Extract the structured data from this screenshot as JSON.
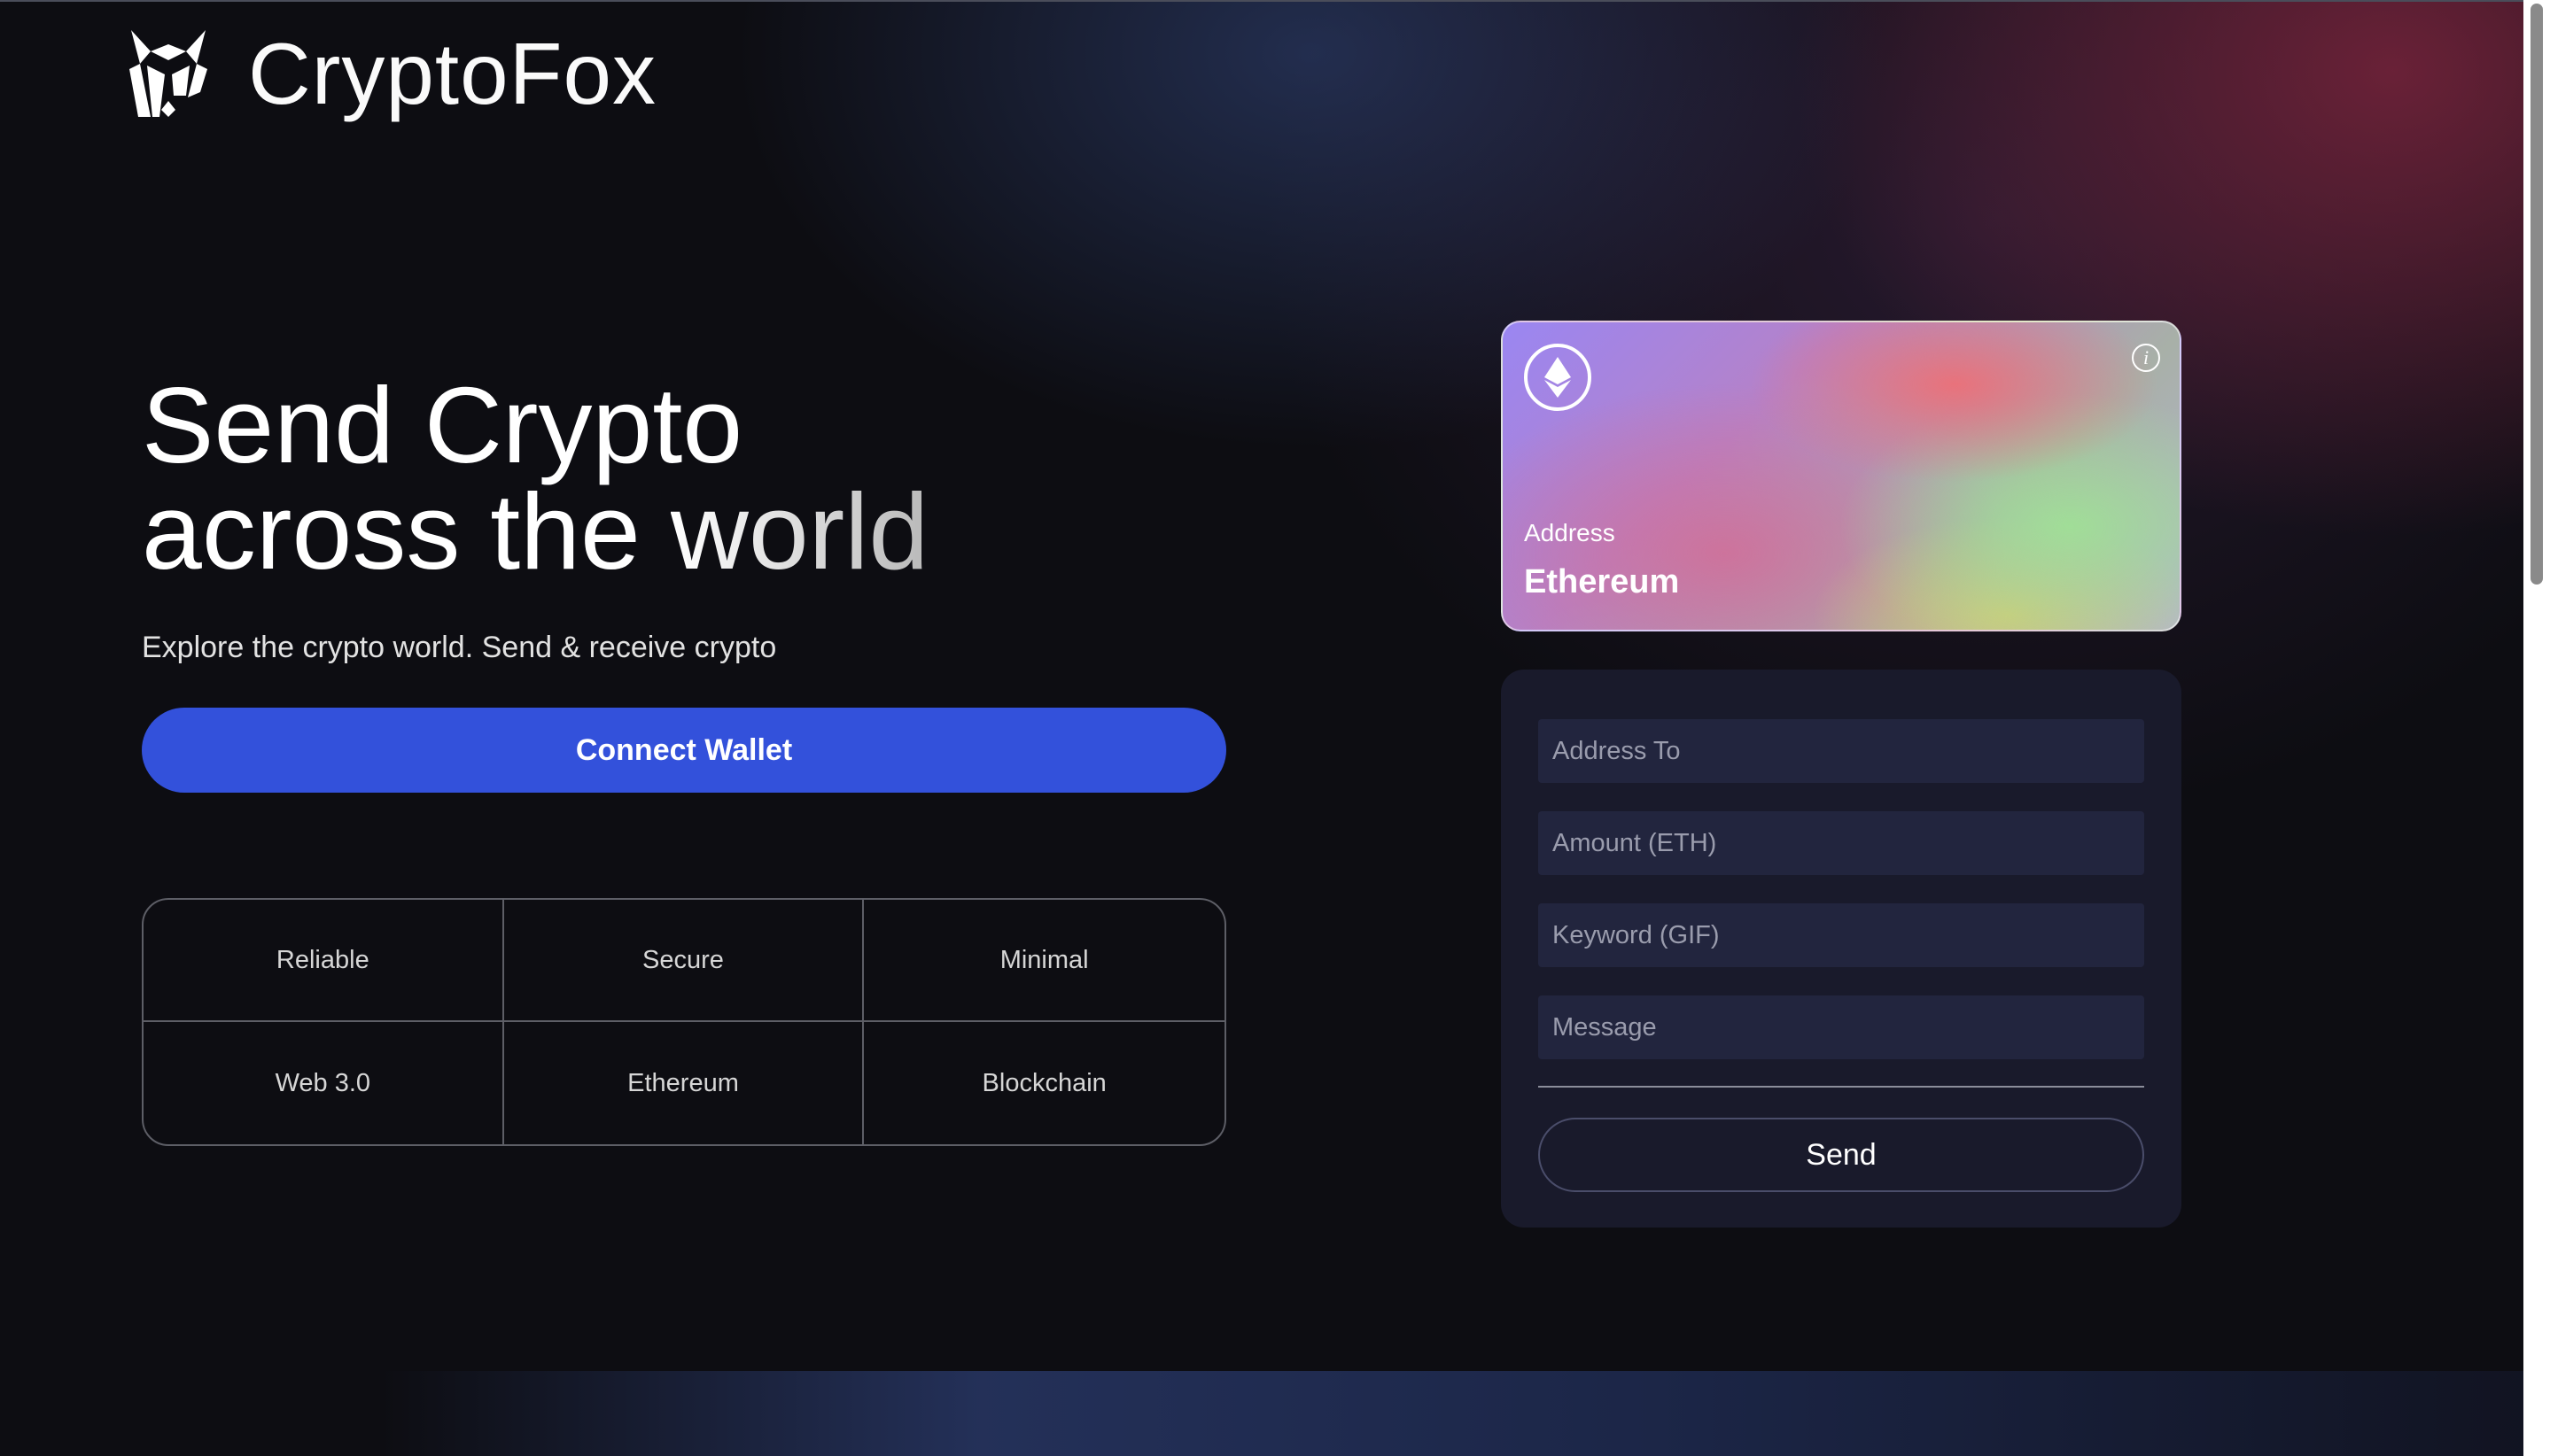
{
  "brand": {
    "name": "CryptoFox",
    "logo_icon": "fox-logo-icon"
  },
  "hero": {
    "title_line1": "Send Crypto",
    "title_line2_plain": "across the ",
    "title_line2_accent": "world",
    "subtitle": "Explore the crypto world. Send & receive crypto"
  },
  "connect_wallet": {
    "label": "Connect Wallet",
    "color": "#3351db"
  },
  "features": [
    "Reliable",
    "Secure",
    "Minimal",
    "Web 3.0",
    "Ethereum",
    "Blockchain"
  ],
  "card": {
    "icon": "ethereum-icon",
    "info_icon": "info-icon",
    "address_label": "Address",
    "network": "Ethereum"
  },
  "form": {
    "address_placeholder": "Address To",
    "amount_placeholder": "Amount (ETH)",
    "keyword_placeholder": "Keyword (GIF)",
    "message_placeholder": "Message",
    "send_label": "Send"
  },
  "colors": {
    "background": "#0d0d12",
    "panel": "#191a2b",
    "input": "#22253e"
  }
}
